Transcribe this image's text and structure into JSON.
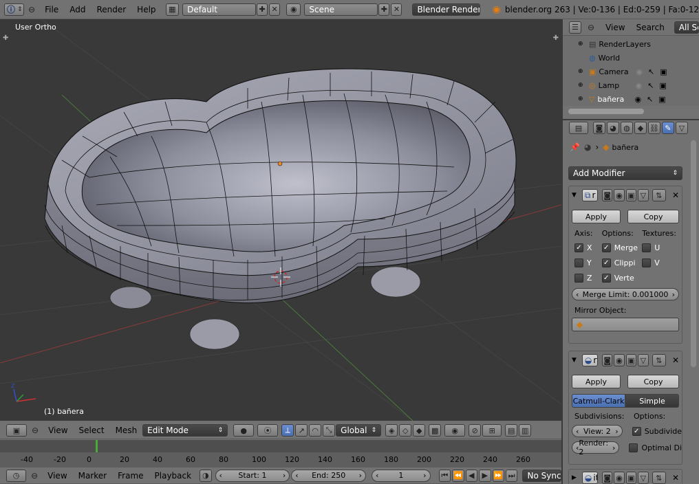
{
  "topbar": {
    "menus": [
      "File",
      "Add",
      "Render",
      "Help"
    ],
    "layout": "Default",
    "scene": "Scene",
    "engine": "Blender Render",
    "stats": "blender.org 263 | Ve:0-136 | Ed:0-259 | Fa:0-12"
  },
  "viewport": {
    "view_label": "User Ortho",
    "object_label": "(1) bañera"
  },
  "view3d_header": {
    "menus": [
      "View",
      "Select",
      "Mesh"
    ],
    "mode": "Edit Mode",
    "orientation": "Global"
  },
  "timeline": {
    "ticks": [
      "-40",
      "-20",
      "0",
      "20",
      "40",
      "60",
      "80",
      "100",
      "120",
      "140",
      "160",
      "180",
      "200",
      "220",
      "240",
      "260"
    ],
    "menus": [
      "View",
      "Marker",
      "Frame",
      "Playback"
    ],
    "start": "Start: 1",
    "end": "End: 250",
    "current": "1",
    "sync": "No Sync"
  },
  "outliner": {
    "menus": [
      "View",
      "Search"
    ],
    "filter": "All Scenes",
    "items": [
      {
        "name": "RenderLayers"
      },
      {
        "name": "World"
      },
      {
        "name": "Camera"
      },
      {
        "name": "Lamp"
      },
      {
        "name": "bañera"
      }
    ]
  },
  "properties": {
    "breadcrumb": "bañera",
    "add_modifier": "Add Modifier",
    "mirror": {
      "name": "r",
      "apply": "Apply",
      "copy": "Copy",
      "axis_label": "Axis:",
      "options_label": "Options:",
      "textures_label": "Textures:",
      "axis": [
        "X",
        "Y",
        "Z"
      ],
      "options": [
        "Merge",
        "Clippi",
        "Verte"
      ],
      "textures": [
        "U",
        "V"
      ],
      "merge_limit": "Merge Limit: 0.001000",
      "mirror_object_label": "Mirror Object:"
    },
    "subsurf": {
      "name": "rf",
      "apply": "Apply",
      "copy": "Copy",
      "tab_catmull": "Catmull-Clark",
      "tab_simple": "Simple",
      "subdivisions_label": "Subdivisions:",
      "options_label": "Options:",
      "view": "View: 2",
      "render": "Render: 2",
      "opt_subdivide": "Subdivide",
      "opt_optimal": "Optimal Di"
    },
    "third_mod_name": "it"
  }
}
